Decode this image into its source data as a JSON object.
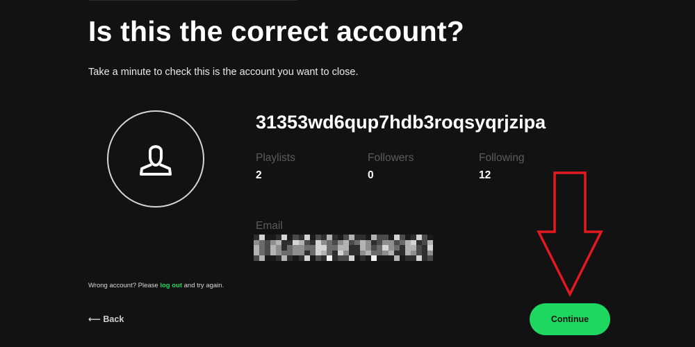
{
  "page": {
    "title": "Is this the correct account?",
    "subtitle": "Take a minute to check this is the account you want to close."
  },
  "profile": {
    "avatar_icon": "user-icon",
    "username": "31353wd6qup7hdb3roqsyqrjzipa",
    "stats": [
      {
        "label": "Playlists",
        "value": "2"
      },
      {
        "label": "Followers",
        "value": "0"
      },
      {
        "label": "Following",
        "value": "12"
      }
    ],
    "email_label": "Email",
    "email_state": "pixelated / redacted"
  },
  "footer": {
    "wrong_account_prefix": "Wrong account? Please",
    "logout_link": "log out",
    "wrong_account_suffix": "and try again.",
    "back_label": "⟵ Back",
    "continue_label": "Continue"
  },
  "annotation": {
    "type": "arrow-down",
    "color": "#e3191f"
  },
  "colors": {
    "background": "#121212",
    "accent": "#1ed760",
    "muted_text": "#5c5c5c",
    "text": "#ffffff"
  }
}
